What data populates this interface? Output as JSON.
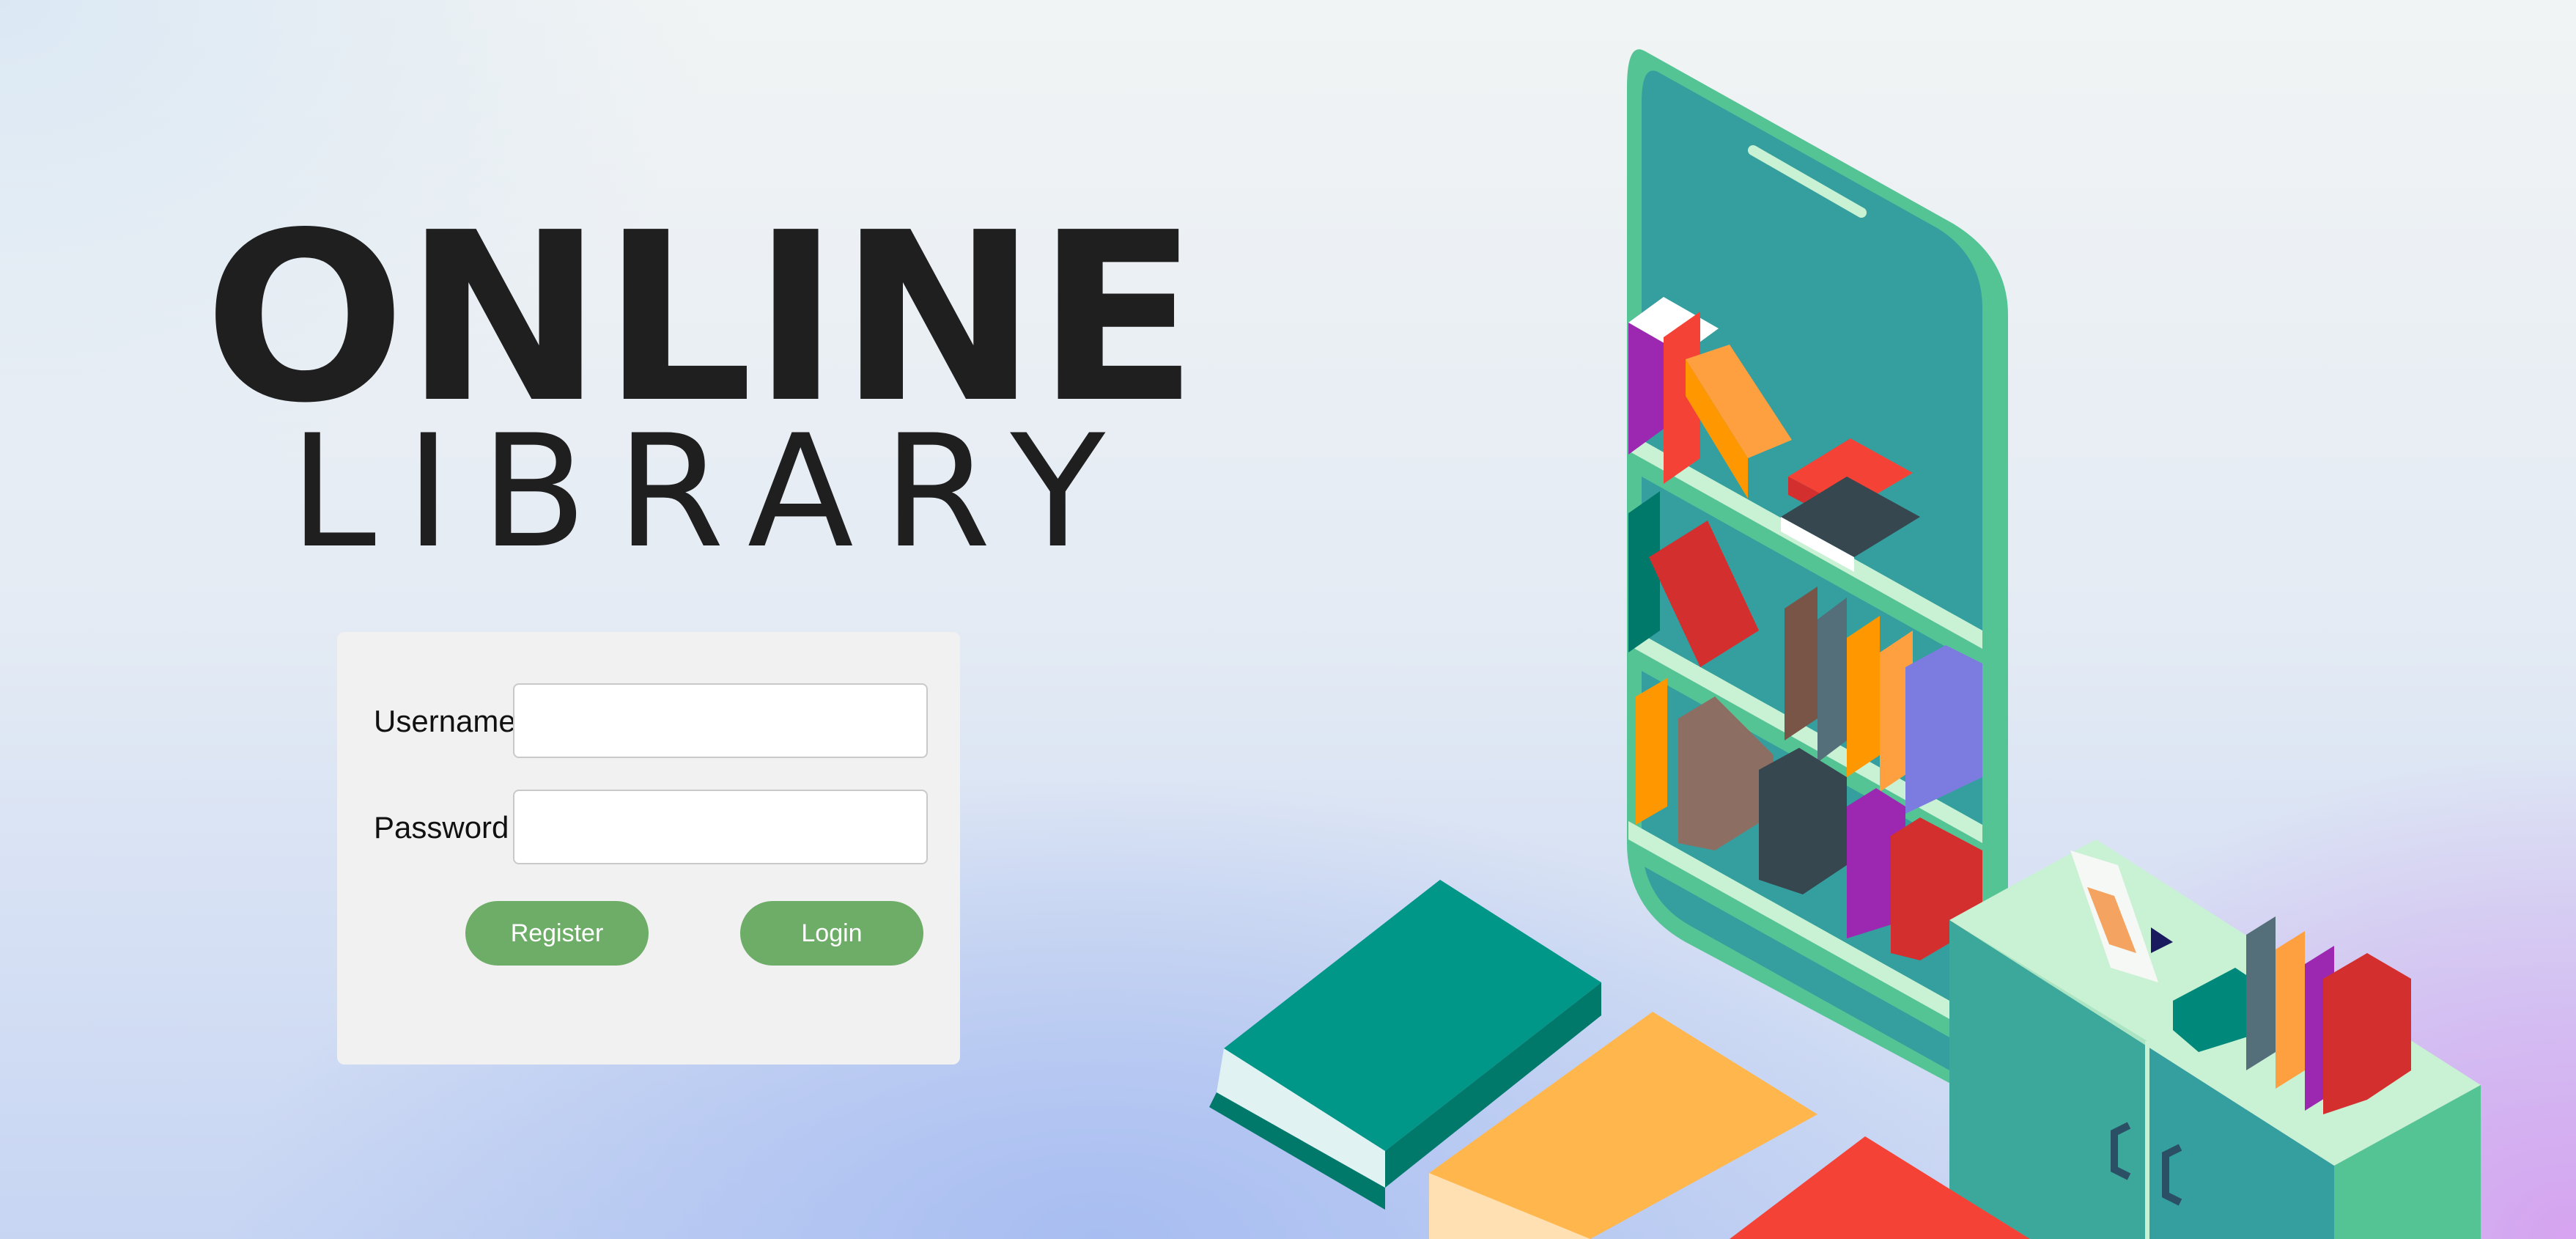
{
  "header": {
    "title_line1": "ONLINE",
    "title_line2": "LIBRARY"
  },
  "login_form": {
    "username_label": "Username",
    "username_value": "",
    "password_label": "Password",
    "password_value": "",
    "register_label": "Register",
    "login_label": "Login"
  },
  "colors": {
    "button_green": "#6dad68",
    "panel_bg": "#f1f1f1",
    "title_text": "#1f1f1f",
    "phone_teal": "#349f9e",
    "phone_frame": "#55c495",
    "shelf_mint": "#c9f1d3"
  },
  "illustration": {
    "icon": "isometric-phone-bookshelf-illustration"
  }
}
